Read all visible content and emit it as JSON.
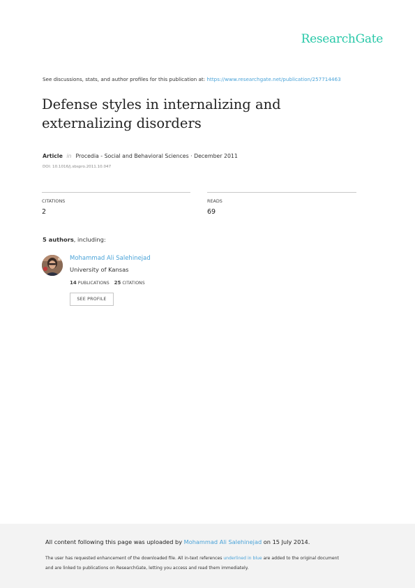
{
  "brand": {
    "name": "ResearchGate",
    "accent": "#28c8a8",
    "link_color": "#4aa3d8"
  },
  "discuss": {
    "prefix": "See discussions, stats, and author profiles for this publication at: ",
    "url": "https://www.researchgate.net/publication/257714463"
  },
  "title": "Defense styles in internalizing and externalizing disorders",
  "meta": {
    "type": "Article",
    "in": "in",
    "journal": "Procedia - Social and Behavioral Sciences · December 2011",
    "doi": "DOI: 10.1016/j.sbspro.2011.10.047"
  },
  "stats": {
    "citations_label": "CITATIONS",
    "citations_value": "2",
    "reads_label": "READS",
    "reads_value": "69"
  },
  "authors": {
    "count_bold": "5 authors",
    "count_rest": ", including:",
    "list": [
      {
        "name": "Mohammad Ali Salehinejad",
        "institution": "University of Kansas",
        "publications_count": "14",
        "publications_label": "PUBLICATIONS",
        "citations_count": "25",
        "citations_label": "CITATIONS",
        "button": "SEE PROFILE"
      }
    ]
  },
  "footer": {
    "uploaded_prefix": "All content following this page was uploaded by ",
    "uploader": "Mohammad Ali Salehinejad",
    "uploaded_suffix": " on 15 July 2014.",
    "note1_prefix": "The user has requested enhancement of the downloaded file. All in-text references ",
    "note1_link": "underlined in blue",
    "note1_suffix": " are added to the original document",
    "note2": "and are linked to publications on ResearchGate, letting you access and read them immediately."
  }
}
